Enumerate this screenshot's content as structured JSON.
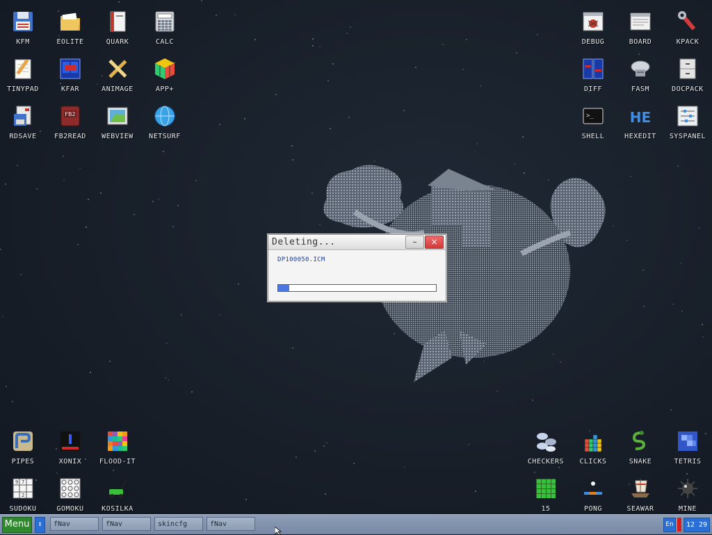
{
  "desktop": {
    "icons": [
      {
        "label": "KFM",
        "icon": "floppy-disk-icon"
      },
      {
        "label": "EOLITE",
        "icon": "folder-icon"
      },
      {
        "label": "QUARK",
        "icon": "book-icon"
      },
      {
        "label": "CALC",
        "icon": "calculator-icon"
      },
      {
        "label": "TINYPAD",
        "icon": "notepad-icon"
      },
      {
        "label": "KFAR",
        "icon": "blue-panels-icon"
      },
      {
        "label": "ANIMAGE",
        "icon": "pencil-ruler-icon"
      },
      {
        "label": "APP+",
        "icon": "rubik-cube-icon"
      },
      {
        "label": "RDSAVE",
        "icon": "disk-save-icon"
      },
      {
        "label": "FB2READ",
        "icon": "fb2-book-icon"
      },
      {
        "label": "WEBVIEW",
        "icon": "web-map-icon"
      },
      {
        "label": "NETSURF",
        "icon": "globe-icon"
      },
      {
        "label": "DEBUG",
        "icon": "bug-window-icon"
      },
      {
        "label": "BOARD",
        "icon": "board-window-icon"
      },
      {
        "label": "KPACK",
        "icon": "wrench-icon"
      },
      {
        "label": "DIFF",
        "icon": "diff-panels-icon"
      },
      {
        "label": "FASM",
        "icon": "assembler-icon"
      },
      {
        "label": "DOCPACK",
        "icon": "cabinet-icon"
      },
      {
        "label": "SHELL",
        "icon": "terminal-icon"
      },
      {
        "label": "HEXEDIT",
        "icon": "hex-editor-icon"
      },
      {
        "label": "SYSPANEL",
        "icon": "sliders-icon"
      },
      {
        "label": "PIPES",
        "icon": "pipes-icon"
      },
      {
        "label": "XONIX",
        "icon": "xonix-icon"
      },
      {
        "label": "FLOOD-IT",
        "icon": "color-grid-icon"
      },
      {
        "label": "SUDOKU",
        "icon": "sudoku-icon"
      },
      {
        "label": "GOMOKU",
        "icon": "tic-tac-toe-icon"
      },
      {
        "label": "KOSILKA",
        "icon": "lawnmower-icon"
      },
      {
        "label": "CHECKERS",
        "icon": "checkers-icon"
      },
      {
        "label": "CLICKS",
        "icon": "blocks-icon"
      },
      {
        "label": "SNAKE",
        "icon": "snake-icon"
      },
      {
        "label": "TETRIS",
        "icon": "tetris-icon"
      },
      {
        "label": "15",
        "icon": "fifteen-puzzle-icon"
      },
      {
        "label": "PONG",
        "icon": "pong-icon"
      },
      {
        "label": "SEAWAR",
        "icon": "ship-icon"
      },
      {
        "label": "MINE",
        "icon": "mine-icon"
      }
    ]
  },
  "dialog": {
    "title": "Deleting...",
    "minimize_glyph": "–",
    "close_glyph": "×",
    "filename": "DP100050.ICM",
    "progress": 0.07
  },
  "taskbar": {
    "menu_label": "Menu",
    "switch_glyph": "↕",
    "tasks": [
      "fNav",
      "fNav",
      "skincfg",
      "fNav"
    ],
    "language": "En",
    "clock": "12 29"
  },
  "colors": {
    "desktop_bg": "#171e28",
    "menu_green": "#2e8a2c",
    "tray_blue": "#2a6fd6",
    "indicator_red": "#d81e1e"
  }
}
